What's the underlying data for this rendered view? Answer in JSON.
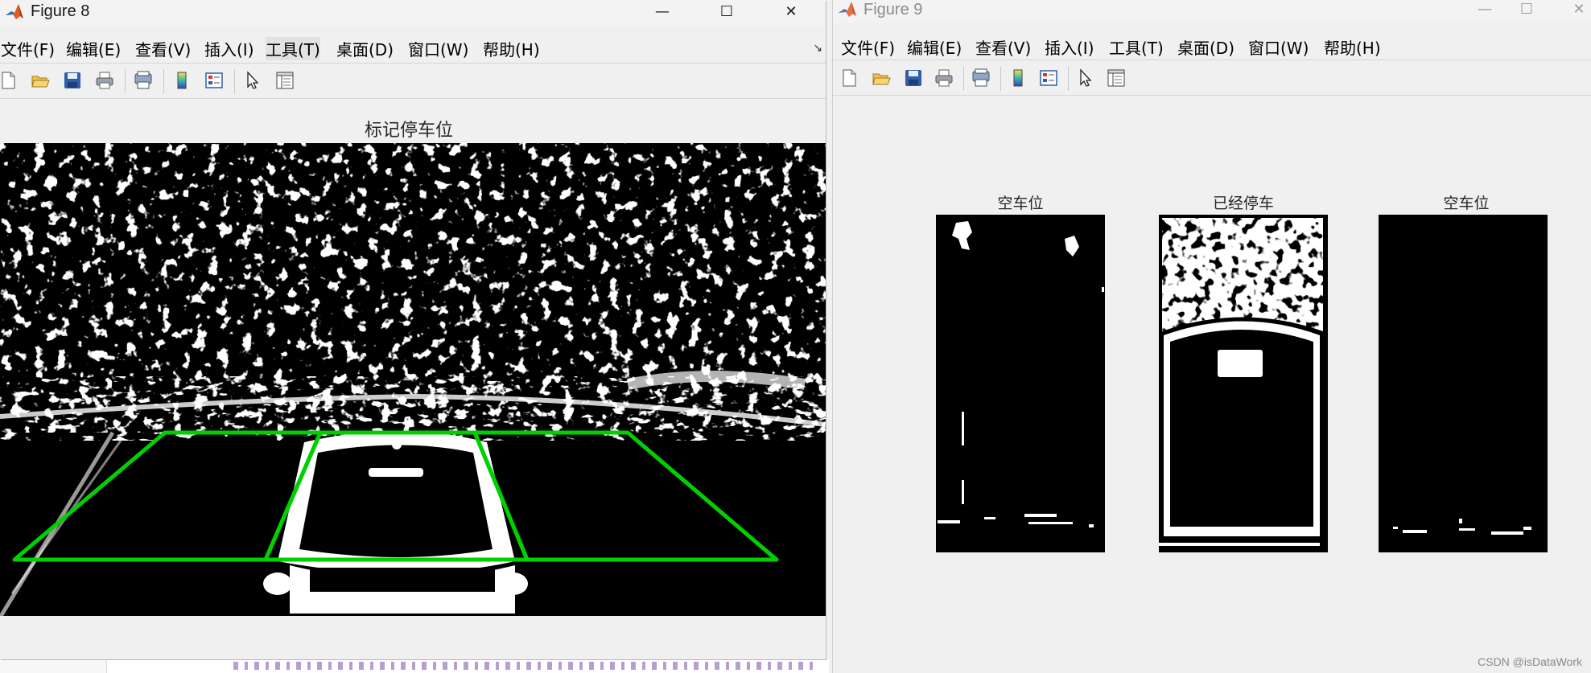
{
  "figure8": {
    "title": "Figure 8",
    "controls": {
      "minimize": "—",
      "maximize": "☐",
      "close": "✕"
    },
    "menu": [
      "文件(F)",
      "编辑(E)",
      "查看(V)",
      "插入(I)",
      "工具(T)",
      "桌面(D)",
      "窗口(W)",
      "帮助(H)"
    ],
    "dock_arrow": "↘",
    "axes_title": "标记停车位",
    "parking_spots_drawn": 3,
    "outline_color": "#00d000"
  },
  "figure9": {
    "title": "Figure 9",
    "controls": {
      "minimize": "—",
      "maximize": "☐",
      "close": "✕"
    },
    "menu": [
      "文件(F)",
      "编辑(E)",
      "查看(V)",
      "插入(I)",
      "工具(T)",
      "桌面(D)",
      "窗口(W)",
      "帮助(H)"
    ],
    "subplots": [
      {
        "title": "空车位",
        "state": "empty"
      },
      {
        "title": "已经停车",
        "state": "occupied"
      },
      {
        "title": "空车位",
        "state": "empty"
      }
    ]
  },
  "toolbar_icons": [
    "new-figure-icon",
    "open-folder-icon",
    "save-icon",
    "print-icon",
    "print-preview-icon",
    "colorbar-icon",
    "legend-icon",
    "pointer-icon",
    "property-inspector-icon"
  ],
  "watermark": "CSDN @isDataWork"
}
